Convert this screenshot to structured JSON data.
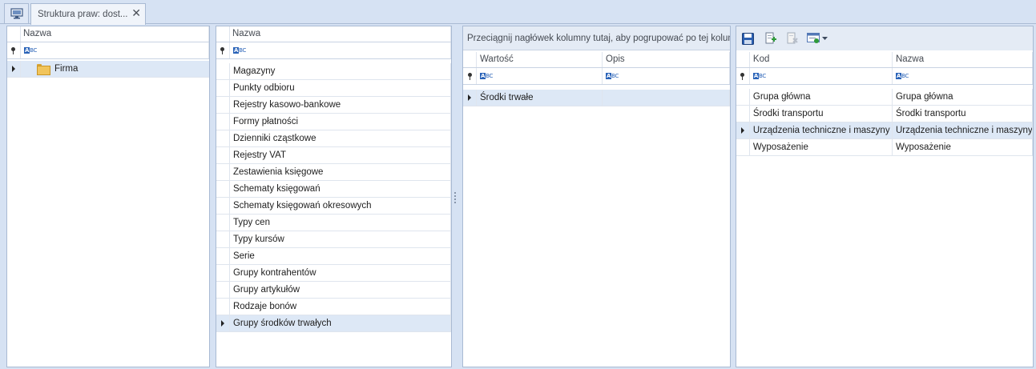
{
  "tabs": {
    "home_icon": "monitor-icon",
    "active_title": "Struktura praw: dost...",
    "close_glyph": "✕"
  },
  "panel1": {
    "header": "Nazwa",
    "tree": [
      {
        "label": "Firma",
        "icon": "folder-icon"
      }
    ]
  },
  "panel2": {
    "header": "Nazwa",
    "items": [
      "Magazyny",
      "Punkty odbioru",
      "Rejestry kasowo-bankowe",
      "Formy płatności",
      "Dzienniki cząstkowe",
      "Rejestry VAT",
      "Zestawienia księgowe",
      "Schematy księgowań",
      "Schematy księgowań okresowych",
      "Typy cen",
      "Typy kursów",
      "Serie",
      "Grupy kontrahentów",
      "Grupy artykułów",
      "Rodzaje bonów",
      "Grupy środków trwałych"
    ],
    "selected_index": 15
  },
  "panel3": {
    "group_hint": "Przeciągnij nagłówek kolumny tutaj, aby pogrupować po tej kolumnie",
    "headers": [
      "Wartość",
      "Opis"
    ],
    "rows": [
      {
        "wartosc": "Środki trwałe",
        "opis": ""
      }
    ]
  },
  "panel4": {
    "toolbar": [
      "save-icon",
      "add-icon",
      "delete-icon",
      "view-icon",
      "dropdown-arrow-icon"
    ],
    "headers": [
      "Kod",
      "Nazwa"
    ],
    "rows": [
      {
        "kod": "Grupa główna",
        "nazwa": "Grupa główna"
      },
      {
        "kod": "Środki transportu",
        "nazwa": "Środki transportu"
      },
      {
        "kod": "Urządzenia techniczne i maszyny",
        "nazwa": "Urządzenia techniczne i maszyny"
      },
      {
        "kod": "Wyposażenie",
        "nazwa": "Wyposażenie"
      }
    ],
    "selected_index": 2
  },
  "filter_icon_text": "BC",
  "filter_icon_prefix": "A"
}
